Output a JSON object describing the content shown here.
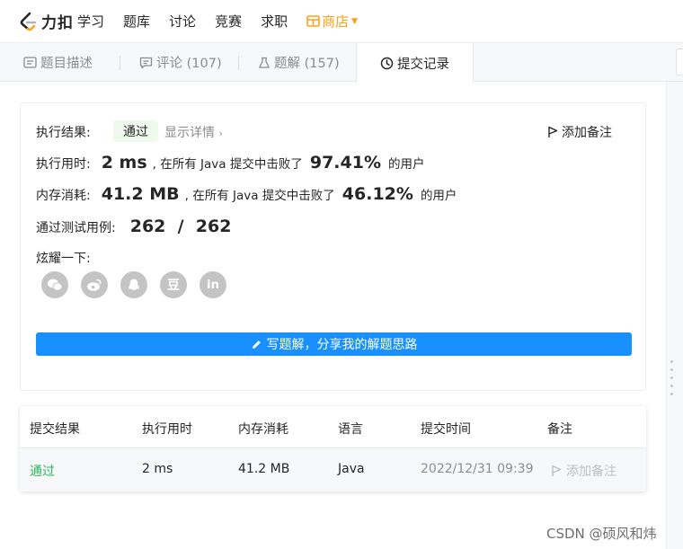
{
  "nav": {
    "logo_text": "力扣",
    "items": [
      "学习",
      "题库",
      "讨论",
      "竞赛",
      "求职"
    ],
    "store_label": "商店",
    "accent_color": "#ffa116"
  },
  "tabs": [
    {
      "label": "题目描述",
      "icon": "description-icon"
    },
    {
      "label": "评论 (107)",
      "icon": "comment-icon"
    },
    {
      "label": "题解 (157)",
      "icon": "flask-icon"
    },
    {
      "label": "提交记录",
      "icon": "clock-icon",
      "active": true
    }
  ],
  "result": {
    "status_label": "执行结果:",
    "status_value": "通过",
    "detail_link": "显示详情",
    "note_button": "添加备注",
    "runtime_label": "执行用时:",
    "runtime_value": "2 ms",
    "runtime_text": ", 在所有 Java 提交中击败了",
    "runtime_pct": "97.41%",
    "runtime_suffix": "的用户",
    "memory_label": "内存消耗:",
    "memory_value": "41.2 MB",
    "memory_text": ", 在所有 Java 提交中击败了",
    "memory_pct": "46.12%",
    "memory_suffix": "的用户",
    "cases_label": "通过测试用例:",
    "cases_value": "262  /  262",
    "share_label": "炫耀一下:",
    "share_icons": [
      "wechat-icon",
      "weibo-icon",
      "qq-icon",
      "douban-icon",
      "linkedin-icon"
    ],
    "douban_glyph": "豆",
    "linkedin_glyph": "in",
    "write_button": "写题解，分享我的解题思路"
  },
  "table": {
    "headers": [
      "提交结果",
      "执行用时",
      "内存消耗",
      "语言",
      "提交时间",
      "备注"
    ],
    "rows": [
      {
        "result": "通过",
        "runtime": "2 ms",
        "memory": "41.2 MB",
        "language": "Java",
        "time": "2022/12/31 09:39",
        "note": "添加备注"
      }
    ]
  },
  "watermark": "CSDN @硕风和炜"
}
